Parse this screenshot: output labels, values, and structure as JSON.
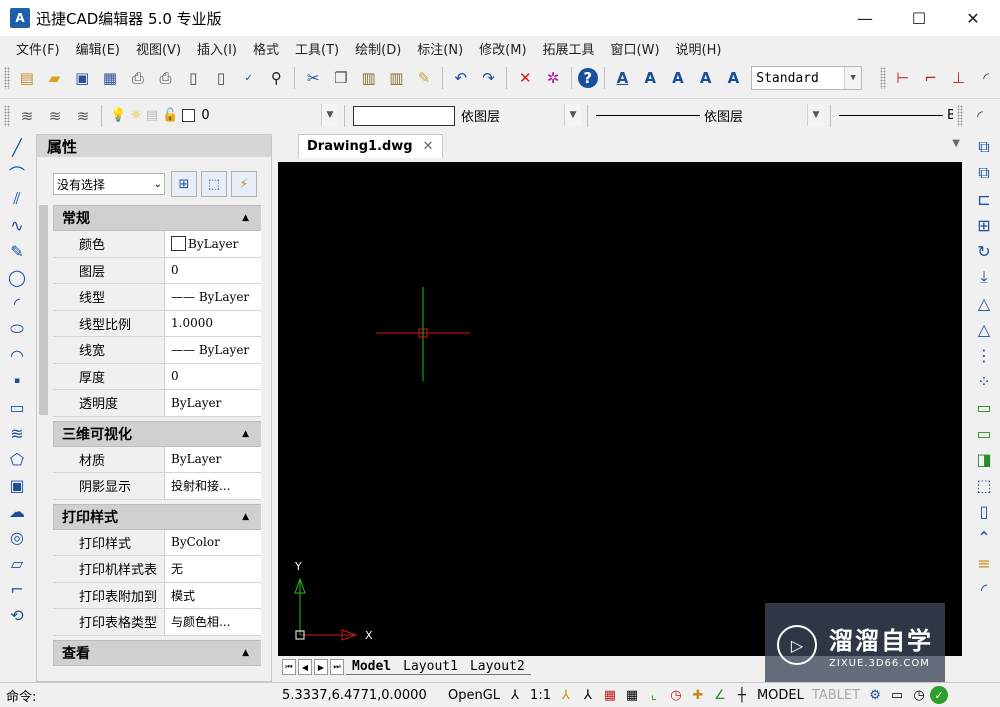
{
  "window": {
    "app_icon": "A",
    "title": "迅捷CAD编辑器 5.0 专业版",
    "controls": [
      "—",
      "☐",
      "✕"
    ]
  },
  "menu": [
    "文件(F)",
    "编辑(E)",
    "视图(V)",
    "插入(I)",
    "格式",
    "工具(T)",
    "绘制(D)",
    "标注(N)",
    "修改(M)",
    "拓展工具",
    "窗口(W)",
    "说明(H)"
  ],
  "toolbar1": {
    "text_style": "Standard"
  },
  "toolbar2": {
    "layer": "0",
    "color": "依图层",
    "linetype": "依图层",
    "lineweight": "B"
  },
  "properties_panel": {
    "title": "属性",
    "selection": "没有选择",
    "sections": [
      {
        "title": "常规",
        "rows": [
          {
            "key": "颜色",
            "value": "ByLayer"
          },
          {
            "key": "图层",
            "value": "0"
          },
          {
            "key": "线型",
            "value": "—— ByLayer"
          },
          {
            "key": "线型比例",
            "value": "1.0000"
          },
          {
            "key": "线宽",
            "value": "—— ByLayer"
          },
          {
            "key": "厚度",
            "value": "0"
          },
          {
            "key": "透明度",
            "value": "ByLayer"
          }
        ]
      },
      {
        "title": "三维可视化",
        "rows": [
          {
            "key": "材质",
            "value": "ByLayer"
          },
          {
            "key": "阴影显示",
            "value": "投射和接..."
          }
        ]
      },
      {
        "title": "打印样式",
        "rows": [
          {
            "key": "打印样式",
            "value": "ByColor"
          },
          {
            "key": "打印机样式表",
            "value": "无"
          },
          {
            "key": "打印表附加到",
            "value": "模式"
          },
          {
            "key": "打印表格类型",
            "value": "与颜色相..."
          }
        ]
      },
      {
        "title": "查看",
        "rows": []
      }
    ]
  },
  "document": {
    "tab": "Drawing1.dwg"
  },
  "canvas": {
    "axis_x": "X",
    "axis_y": "Y"
  },
  "layouts": [
    "Model",
    "Layout1",
    "Layout2"
  ],
  "status": {
    "command_label": "命令:",
    "coordinates": "5.3337,6.4771,0.0000",
    "renderer": "OpenGL",
    "scale": "1:1",
    "model": "MODEL",
    "tablet": "TABLET"
  },
  "watermark": {
    "title": "溜溜自学",
    "url": "ZIXUE.3D66.COM"
  }
}
